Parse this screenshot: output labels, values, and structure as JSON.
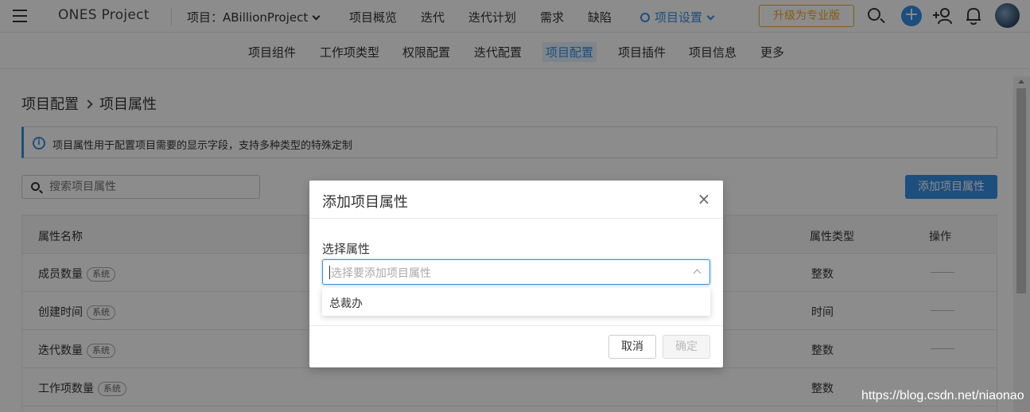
{
  "header": {
    "brand": "ONES Project",
    "project_label": "项目：ABillionProject",
    "nav": [
      "项目概览",
      "迭代",
      "迭代计划",
      "需求",
      "缺陷"
    ],
    "settings_label": "项目设置",
    "upgrade_label": "升级为专业版",
    "accent_color": "#338fe5",
    "upgrade_color": "#f5a623"
  },
  "subnav": {
    "items": [
      "项目组件",
      "工作项类型",
      "权限配置",
      "迭代配置",
      "项目配置",
      "项目插件",
      "项目信息",
      "更多"
    ],
    "active": "项目配置"
  },
  "breadcrumb": {
    "parent": "项目配置",
    "current": "项目属性"
  },
  "info": {
    "text": "项目属性用于配置项目需要的显示字段，支持多种类型的特殊定制"
  },
  "search": {
    "placeholder": "搜索项目属性"
  },
  "add_button": "添加项目属性",
  "table": {
    "headers": {
      "name": "属性名称",
      "type": "属性类型",
      "action": "操作"
    },
    "rows": [
      {
        "name": "成员数量",
        "tag": "系统",
        "type": "整数"
      },
      {
        "name": "创建时间",
        "tag": "系统",
        "type": "时间"
      },
      {
        "name": "迭代数量",
        "tag": "系统",
        "type": "整数"
      },
      {
        "name": "工作项数量",
        "tag": "系统",
        "type": "整数"
      }
    ]
  },
  "modal": {
    "title": "添加项目属性",
    "field_label": "选择属性",
    "select_placeholder": "选择要添加项目属性",
    "options": [
      "总裁办"
    ],
    "cancel_label": "取消",
    "ok_label": "确定"
  },
  "watermark": "https://blog.csdn.net/niaonao"
}
